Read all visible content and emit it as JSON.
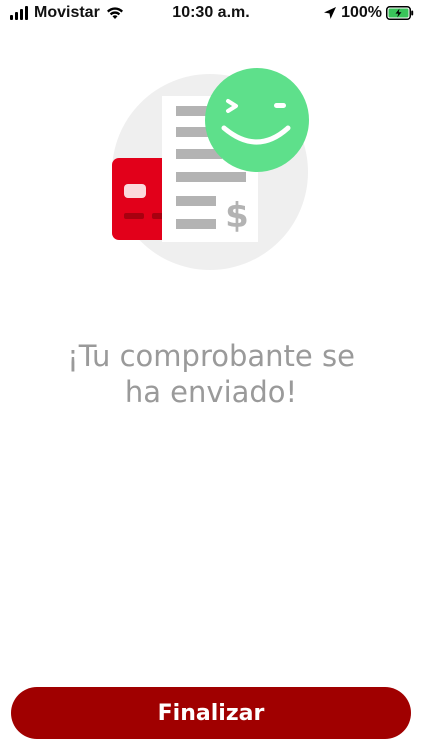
{
  "status_bar": {
    "carrier": "Movistar",
    "time": "10:30 a.m.",
    "battery": "100%"
  },
  "message": {
    "line1": "¡Tu comprobante se",
    "line2": "ha enviado!"
  },
  "actions": {
    "finalize_label": "Finalizar"
  },
  "colors": {
    "accent": "#a00000",
    "card_red": "#e2001a",
    "smiley_green": "#5ee08b",
    "circle_bg": "#efefef",
    "text_muted": "#9a9a9a"
  },
  "illustration": {
    "currency_symbol": "$"
  }
}
